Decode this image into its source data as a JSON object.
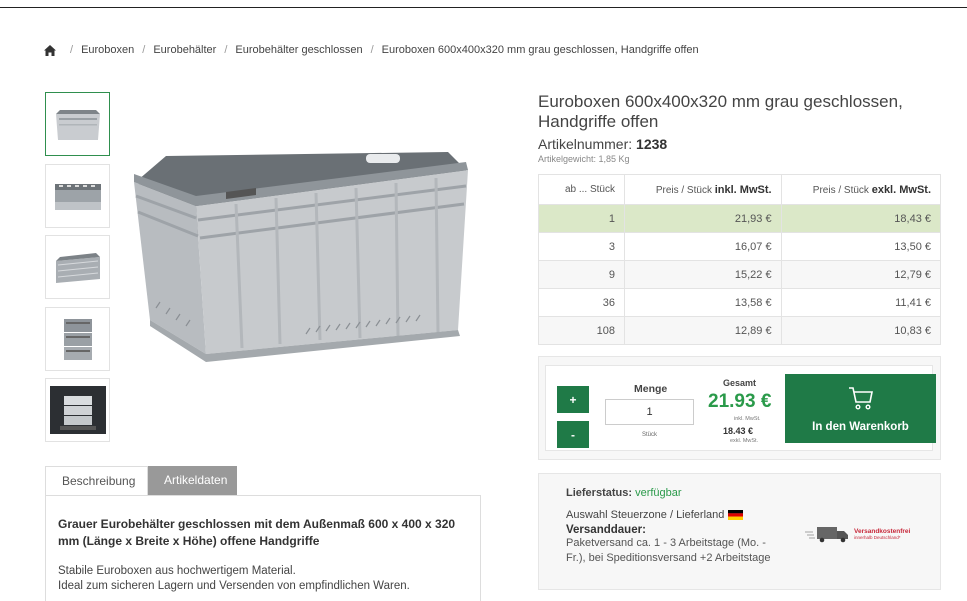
{
  "breadcrumb": {
    "items": [
      "Euroboxen",
      "Eurobehälter",
      "Eurobehälter geschlossen",
      "Euroboxen 600x400x320 mm grau geschlossen, Handgriffe offen"
    ]
  },
  "gallery": {
    "thumbnails": [
      "Eurobox grau",
      "Euroboxen gestapelt",
      "Euroboxen mit Deckel",
      "Euroboxen Stapel",
      "Euroboxen auf Palette"
    ],
    "active_index": 0
  },
  "tabs": {
    "items": [
      "Beschreibung",
      "Artikeldaten"
    ],
    "active_index": 1
  },
  "description": {
    "lead": "Grauer Eurobehälter geschlossen mit dem Außenmaß 600 x 400 x 320 mm (Länge x Breite x Höhe) offene Handgriffe",
    "line1": "Stabile Euroboxen aus hochwertigem Material.",
    "line2": "Ideal zum sicheren Lagern und Versenden von empfindlichen Waren."
  },
  "product": {
    "title": "Euroboxen 600x400x320 mm grau geschlossen, Handgriffe offen",
    "artnr_label": "Artikelnummer: ",
    "artnr": "1238",
    "weight": "Artikelgewicht: 1,85 Kg"
  },
  "price_table": {
    "headers": {
      "col1": "ab ... Stück",
      "col2_prefix": "Preis / Stück ",
      "col2_strong": "inkl. MwSt.",
      "col3_prefix": "Preis / Stück ",
      "col3_strong": "exkl. MwSt."
    },
    "rows": [
      {
        "qty": "1",
        "incl": "21,93 €",
        "excl": "18,43 €"
      },
      {
        "qty": "3",
        "incl": "16,07 €",
        "excl": "13,50 €"
      },
      {
        "qty": "9",
        "incl": "15,22 €",
        "excl": "12,79 €"
      },
      {
        "qty": "36",
        "incl": "13,58 €",
        "excl": "11,41 €"
      },
      {
        "qty": "108",
        "incl": "12,89 €",
        "excl": "10,83 €"
      }
    ]
  },
  "cart": {
    "plus": "+",
    "minus": "-",
    "menge_label": "Menge",
    "qty_value": "1",
    "unit": "Stück",
    "gesamt_label": "Gesamt",
    "gesamt_value": "21.93 €",
    "inkl_label": "inkl. MwSt.",
    "exkl_value": "18.43 €",
    "exkl_label": "exkl. MwSt.",
    "button_label": "In den Warenkorb"
  },
  "delivery": {
    "status_label": "Lieferstatus:",
    "status_value": "verfügbar",
    "zone_label": "Auswahl Steuerzone / Lieferland",
    "duration_label": "Versanddauer:",
    "duration_text": "Paketversand ca. 1 - 3 Arbeitstage (Mo. - Fr.), bei Speditionsversand +2 Arbeitstage",
    "shipping_badge_title": "Versandkostenfrei",
    "shipping_badge_sub": "innerhalb Deutschland*"
  },
  "colors": {
    "accent_green": "#1f7a47",
    "price_green": "#2a9a4a",
    "highlight_row": "#dbe8c8"
  }
}
